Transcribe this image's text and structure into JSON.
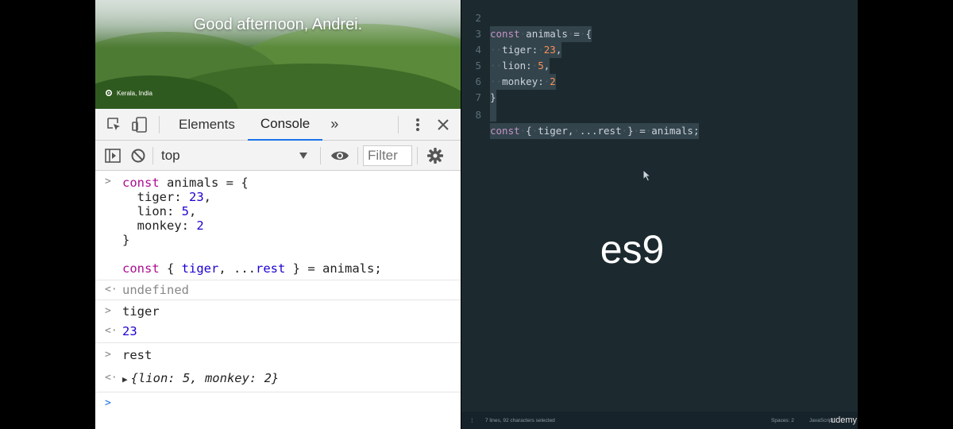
{
  "browser": {
    "greeting": "Good afternoon, Andrei.",
    "location": "Kerala, India"
  },
  "devtools": {
    "tabs": [
      {
        "label": "Elements"
      },
      {
        "label": "Console"
      }
    ],
    "more_tabs_glyph": "»",
    "context": "top",
    "filter_placeholder": "Filter",
    "console": {
      "entries": [
        {
          "input_lines": [
            "const animals = {",
            "  tiger: 23,",
            "  lion: 5,",
            "  monkey: 2",
            "}",
            "",
            "const { tiger, ...rest } = animals;"
          ],
          "result": "undefined"
        },
        {
          "input": "tiger",
          "result": "23"
        },
        {
          "input": "rest",
          "result": "{lion: 5, monkey: 2}"
        }
      ]
    }
  },
  "editor": {
    "lines": [
      {
        "num": "2",
        "text": "const animals = {"
      },
      {
        "num": "3",
        "text": "  tiger: 23,"
      },
      {
        "num": "4",
        "text": "  lion: 5,"
      },
      {
        "num": "5",
        "text": "  monkey: 2"
      },
      {
        "num": "6",
        "text": "}"
      },
      {
        "num": "7",
        "text": ""
      },
      {
        "num": "8",
        "text": "const { tiger, ...rest } = animals;"
      }
    ],
    "overlay_title": "es9",
    "status_left": "7 lines, 92 characters selected",
    "status_spaces": "Spaces: 2",
    "status_lang": "JavaScript",
    "watermark": "udemy"
  },
  "colors": {
    "keyword": "#aa0d91",
    "number": "#1c00cf",
    "editor_bg": "#1c2a30",
    "tab_active": "#1a73e8"
  }
}
